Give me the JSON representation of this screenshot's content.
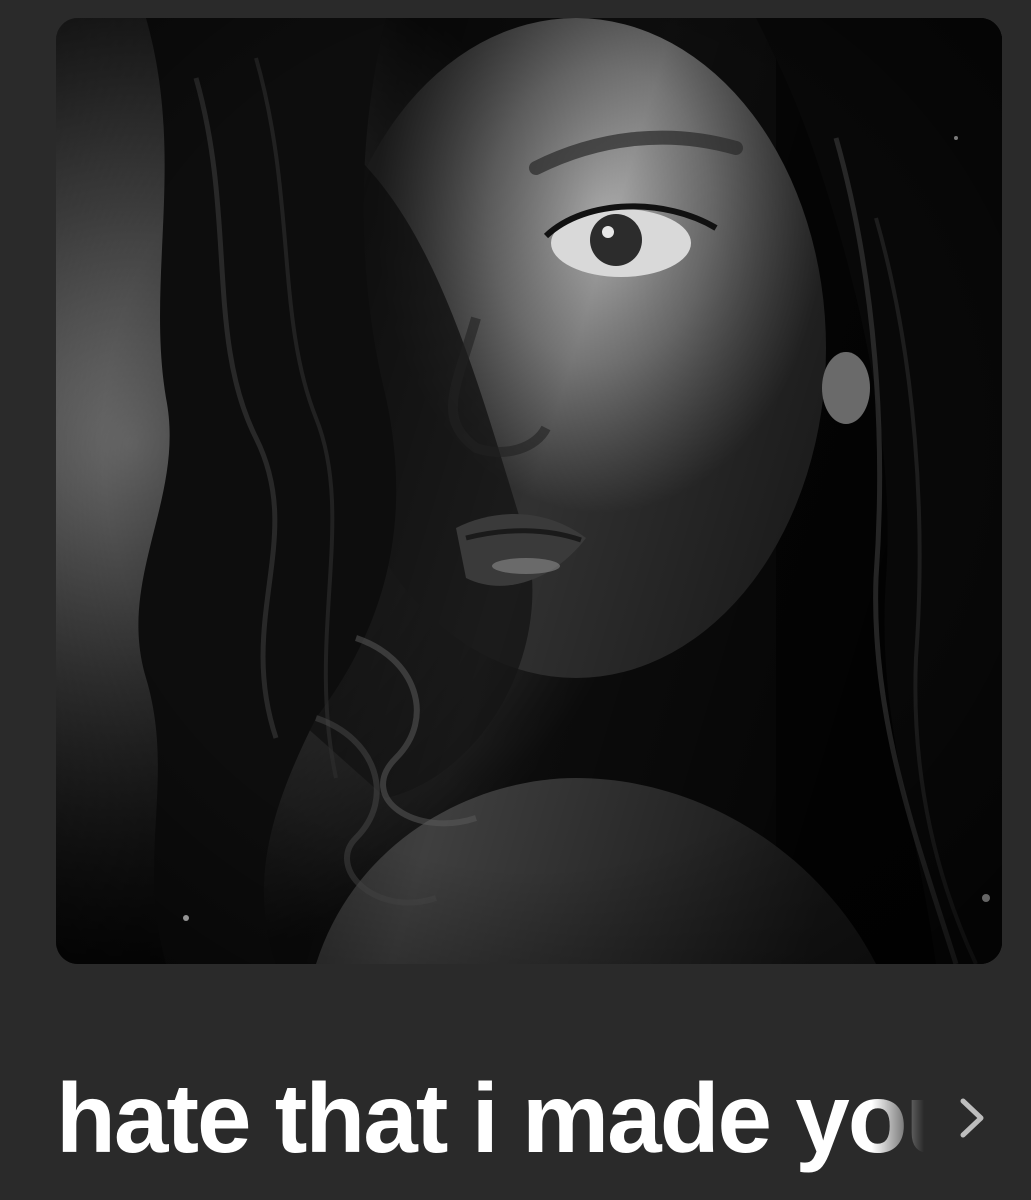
{
  "song": {
    "title": "hate that i made you love me",
    "artwork_alt": "Album artwork: black and white portrait of a woman with long wavy hair"
  },
  "icons": {
    "chevron": "chevron-right-icon"
  },
  "colors": {
    "background": "#2a2a2a",
    "title_text": "#ffffff",
    "chevron": "#bdbdbd"
  }
}
